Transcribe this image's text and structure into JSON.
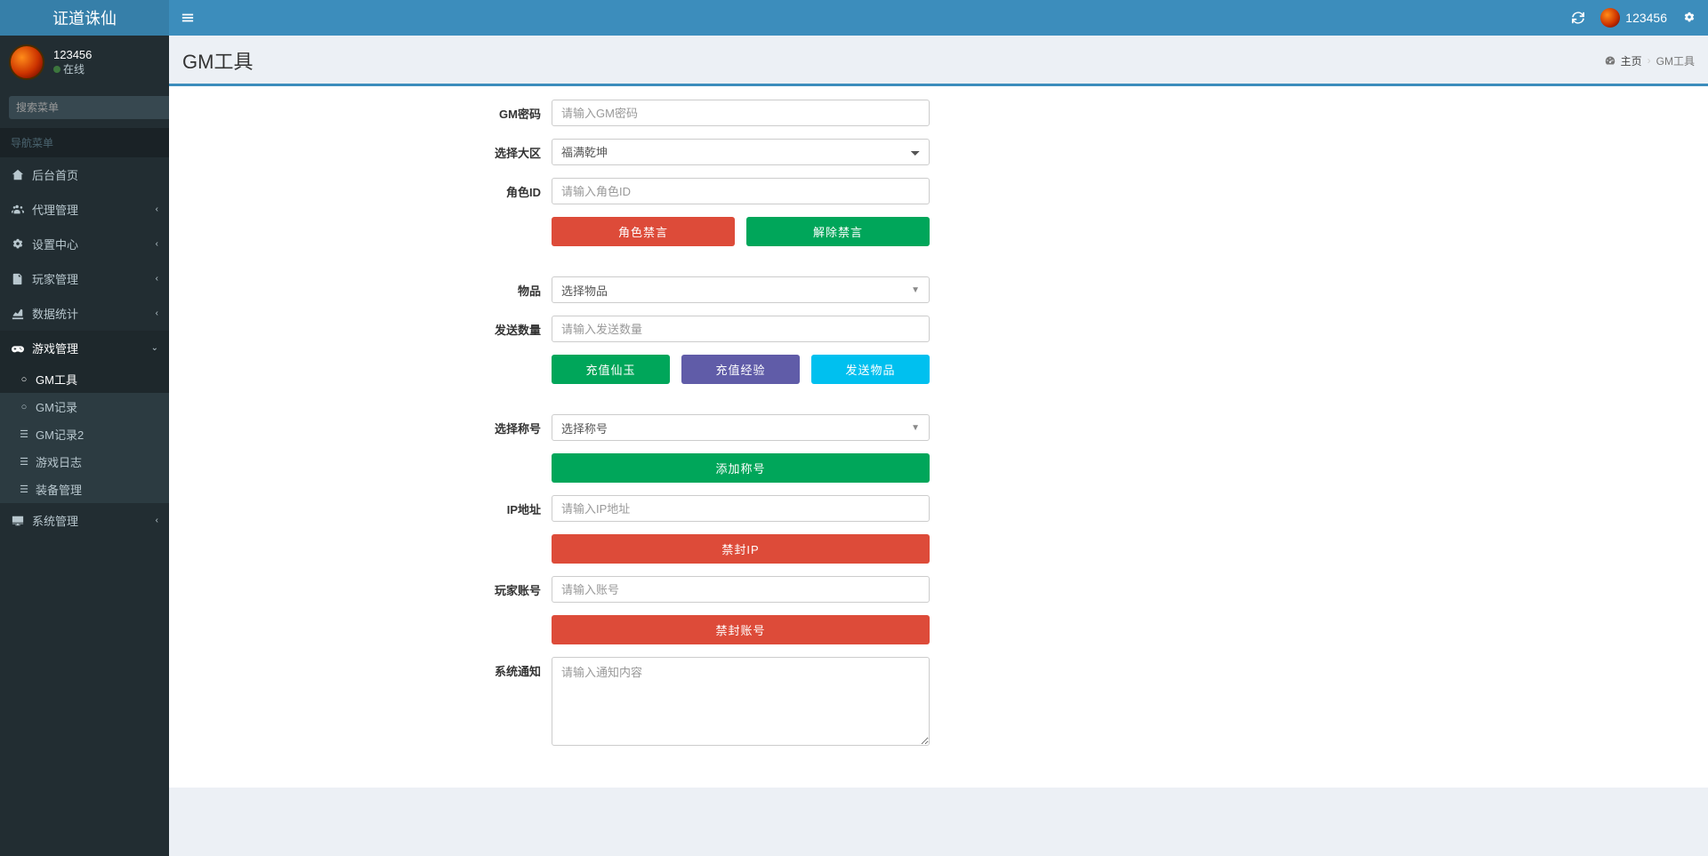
{
  "app": {
    "title": "证道诛仙"
  },
  "user": {
    "name": "123456",
    "status": "在线"
  },
  "search": {
    "placeholder": "搜索菜单"
  },
  "nav_header": "导航菜单",
  "sidebar": {
    "items": [
      {
        "label": "后台首页"
      },
      {
        "label": "代理管理"
      },
      {
        "label": "设置中心"
      },
      {
        "label": "玩家管理"
      },
      {
        "label": "数据统计"
      },
      {
        "label": "游戏管理"
      },
      {
        "label": "系统管理"
      }
    ],
    "game_submenu": [
      {
        "label": "GM工具"
      },
      {
        "label": "GM记录"
      },
      {
        "label": "GM记录2"
      },
      {
        "label": "游戏日志"
      },
      {
        "label": "装备管理"
      }
    ]
  },
  "header": {
    "username": "123456"
  },
  "page": {
    "title": "GM工具"
  },
  "breadcrumb": {
    "home": "主页",
    "current": "GM工具"
  },
  "form": {
    "gm_password": {
      "label": "GM密码",
      "placeholder": "请输入GM密码"
    },
    "zone": {
      "label": "选择大区",
      "selected": "福满乾坤"
    },
    "role_id": {
      "label": "角色ID",
      "placeholder": "请输入角色ID"
    },
    "btn_mute": "角色禁言",
    "btn_unmute": "解除禁言",
    "item": {
      "label": "物品",
      "placeholder": "选择物品"
    },
    "send_count": {
      "label": "发送数量",
      "placeholder": "请输入发送数量"
    },
    "btn_recharge_jade": "充值仙玉",
    "btn_recharge_exp": "充值经验",
    "btn_send_item": "发送物品",
    "title": {
      "label": "选择称号",
      "placeholder": "选择称号"
    },
    "btn_add_title": "添加称号",
    "ip": {
      "label": "IP地址",
      "placeholder": "请输入IP地址"
    },
    "btn_ban_ip": "禁封IP",
    "player_account": {
      "label": "玩家账号",
      "placeholder": "请输入账号"
    },
    "btn_ban_account": "禁封账号",
    "notice": {
      "label": "系统通知",
      "placeholder": "请输入通知内容"
    }
  }
}
